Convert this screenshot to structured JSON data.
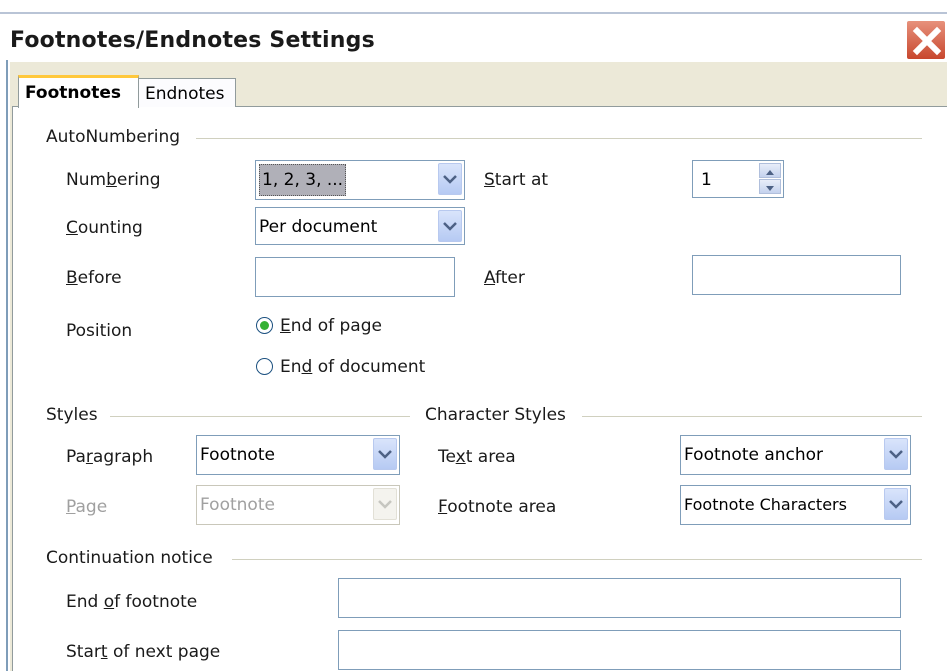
{
  "window": {
    "title": "Footnotes/Endnotes Settings"
  },
  "tabs": [
    {
      "label": "Footnotes",
      "active": true
    },
    {
      "label": "Endnotes",
      "active": false
    }
  ],
  "autonumbering": {
    "heading": "AutoNumbering",
    "numbering": {
      "label_pre": "Num",
      "label_key": "b",
      "label_post": "ering",
      "value": "1, 2, 3, ..."
    },
    "start_at": {
      "label_pre": "",
      "label_key": "S",
      "label_post": "tart at",
      "value": "1"
    },
    "counting": {
      "label_pre": "",
      "label_key": "C",
      "label_post": "ounting",
      "value": "Per document"
    },
    "before": {
      "label_pre": "",
      "label_key": "B",
      "label_post": "efore",
      "value": ""
    },
    "after": {
      "label_pre": "",
      "label_key": "A",
      "label_post": "fter",
      "value": ""
    },
    "position": {
      "label": "Position",
      "options": [
        {
          "label_pre": "",
          "label_key": "E",
          "label_post": "nd of page",
          "checked": true
        },
        {
          "label_pre": "En",
          "label_key": "d",
          "label_post": " of document",
          "checked": false
        }
      ]
    }
  },
  "styles": {
    "heading": "Styles",
    "paragraph": {
      "label_pre": "Pa",
      "label_key": "r",
      "label_post": "agraph",
      "value": "Footnote"
    },
    "page": {
      "label_pre": "",
      "label_key": "P",
      "label_post": "age",
      "value": "Footnote",
      "disabled": true
    }
  },
  "character_styles": {
    "heading": "Character Styles",
    "text_area": {
      "label_pre": "Te",
      "label_key": "x",
      "label_post": "t area",
      "value": "Footnote anchor"
    },
    "footnote_area": {
      "label_pre": "",
      "label_key": "F",
      "label_post": "ootnote area",
      "value": "Footnote Characters"
    }
  },
  "continuation": {
    "heading": "Continuation notice",
    "end_of_footnote": {
      "label_pre": "End ",
      "label_key": "o",
      "label_post": "f footnote",
      "value": ""
    },
    "start_of_next_page": {
      "label_pre": "Star",
      "label_key": "t",
      "label_post": " of next page",
      "value": ""
    }
  },
  "colors": {
    "accent_tab": "#ffc83c",
    "close": "#c8472e",
    "radio_dot": "#35b133"
  }
}
